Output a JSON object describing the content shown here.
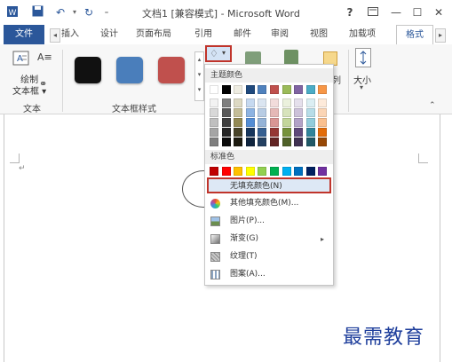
{
  "window": {
    "title": "文档1 [兼容模式] - Microsoft Word",
    "help": "?",
    "restore_icon": "ribbon-display-icon",
    "minimize": "—",
    "maximize": "☐",
    "close": "✕"
  },
  "tabs": [
    "文件",
    "插入",
    "设计",
    "页面布局",
    "引用",
    "邮件",
    "审阅",
    "视图",
    "加载项",
    "格式"
  ],
  "ribbon": {
    "draw_label_line1": "绘制",
    "draw_label_line2": "文本框",
    "group1": "文本",
    "group2": "文本框样式",
    "arrange_fragment": "列",
    "size_label": "大小",
    "swatch_colors": [
      "#111111",
      "#4a7ebb",
      "#c0504d"
    ]
  },
  "dropdown": {
    "theme_colors_title": "主题颜色",
    "standard_colors_title": "标准色",
    "theme_top": [
      "#ffffff",
      "#000000",
      "#eeece1",
      "#1f497d",
      "#4f81bd",
      "#c0504d",
      "#9bbb59",
      "#8064a2",
      "#4bacc6",
      "#f79646"
    ],
    "theme_shades": [
      [
        "#f2f2f2",
        "#7f7f7f",
        "#ddd9c3",
        "#c6d9f0",
        "#dbe5f1",
        "#f2dcdb",
        "#ebf1dd",
        "#e5e0ec",
        "#dbeef3",
        "#fdeada"
      ],
      [
        "#d8d8d8",
        "#595959",
        "#c4bd97",
        "#8db3e2",
        "#b8cce4",
        "#e5b9b7",
        "#d7e3bc",
        "#ccc1d9",
        "#b7dde8",
        "#fbd5b5"
      ],
      [
        "#bfbfbf",
        "#3f3f3f",
        "#938953",
        "#548dd4",
        "#95b3d7",
        "#d99694",
        "#c3d69b",
        "#b2a2c7",
        "#92cddc",
        "#fac08f"
      ],
      [
        "#a5a5a5",
        "#262626",
        "#494429",
        "#17365d",
        "#366092",
        "#953734",
        "#76923c",
        "#5f497a",
        "#31859b",
        "#e36c09"
      ],
      [
        "#7f7f7f",
        "#0c0c0c",
        "#1d1b10",
        "#0f243e",
        "#244061",
        "#632423",
        "#4f6128",
        "#3f3151",
        "#205867",
        "#974806"
      ]
    ],
    "standard": [
      "#c00000",
      "#ff0000",
      "#ffc000",
      "#ffff00",
      "#92d050",
      "#00b050",
      "#00b0f0",
      "#0070c0",
      "#002060",
      "#7030a0"
    ],
    "items": {
      "no_fill": "无填充颜色(N)",
      "more_colors": "其他填充颜色(M)...",
      "picture": "图片(P)...",
      "gradient": "渐变(G)",
      "texture": "纹理(T)",
      "pattern": "图案(A)..."
    }
  },
  "watermark": "最需教育"
}
